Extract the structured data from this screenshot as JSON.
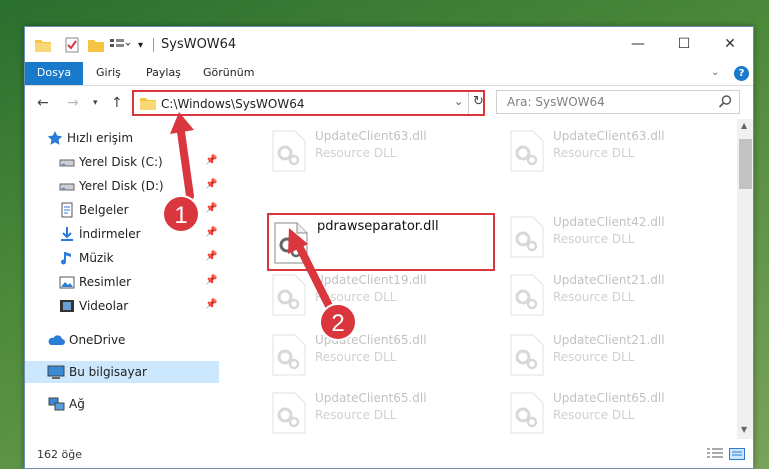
{
  "window": {
    "title": "SysWOW64",
    "controls": {
      "minimize": "—",
      "maximize": "☐",
      "close": "✕"
    }
  },
  "ribbon": {
    "tabs": [
      "Dosya",
      "Giriş",
      "Paylaş",
      "Görünüm"
    ],
    "help": "?"
  },
  "address": {
    "path": "C:\\Windows\\SysWOW64",
    "search_placeholder": "Ara: SysWOW64"
  },
  "sidebar": {
    "items": [
      {
        "label": "Hızlı erişim",
        "icon": "star-icon",
        "pinned": false
      },
      {
        "label": "Yerel Disk (C:)",
        "icon": "drive-icon",
        "pinned": true
      },
      {
        "label": "Yerel Disk (D:)",
        "icon": "drive-icon",
        "pinned": true
      },
      {
        "label": "Belgeler",
        "icon": "documents-icon",
        "pinned": true
      },
      {
        "label": "İndirmeler",
        "icon": "downloads-icon",
        "pinned": true
      },
      {
        "label": "Müzik",
        "icon": "music-icon",
        "pinned": true
      },
      {
        "label": "Resimler",
        "icon": "pictures-icon",
        "pinned": true
      },
      {
        "label": "Videolar",
        "icon": "videos-icon",
        "pinned": true
      },
      {
        "label": "OneDrive",
        "icon": "cloud-icon",
        "pinned": false
      },
      {
        "label": "Bu bilgisayar",
        "icon": "computer-icon",
        "pinned": false,
        "selected": true
      },
      {
        "label": "Ağ",
        "icon": "network-icon",
        "pinned": false
      }
    ]
  },
  "files": {
    "left_column": [
      {
        "name": "UpdateClient63.dll",
        "type": "Resource DLL"
      },
      {
        "name": "UpdateClient19.dll",
        "type": "Resource DLL"
      },
      {
        "name": "UpdateClient65.dll",
        "type": "Resource DLL"
      },
      {
        "name": "UpdateClient65.dll",
        "type": "Resource DLL"
      }
    ],
    "right_column": [
      {
        "name": "UpdateClient63.dll",
        "type": "Resource DLL"
      },
      {
        "name": "UpdateClient42.dll",
        "type": "Resource DLL"
      },
      {
        "name": "UpdateClient21.dll",
        "type": "Resource DLL"
      },
      {
        "name": "UpdateClient21.dll",
        "type": "Resource DLL"
      },
      {
        "name": "UpdateClient65.dll",
        "type": "Resource DLL"
      }
    ],
    "highlighted": {
      "name": "pdrawseparator.dll"
    }
  },
  "status": {
    "count": "162 öğe"
  },
  "annotations": {
    "badge1": "1",
    "badge2": "2"
  },
  "colors": {
    "accent": "#1979ca",
    "highlight": "#d9363e",
    "selection": "#cce8ff"
  }
}
